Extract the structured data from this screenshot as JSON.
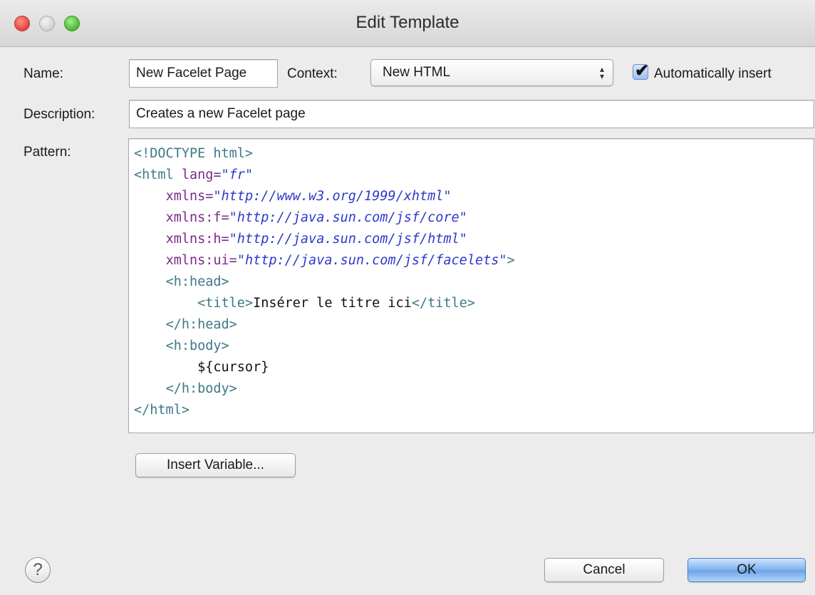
{
  "window": {
    "title": "Edit Template"
  },
  "form": {
    "name_label": "Name:",
    "name_value": "New Facelet Page",
    "context_label": "Context:",
    "context_value": "New HTML",
    "auto_insert_label": "Automatically insert",
    "auto_insert_checked": true,
    "description_label": "Description:",
    "description_value": "Creates a new Facelet page",
    "pattern_label": "Pattern:"
  },
  "pattern": {
    "lines": [
      [
        {
          "t": "tag",
          "s": "<!DOCTYPE html>"
        }
      ],
      [
        {
          "t": "tag",
          "s": "<html "
        },
        {
          "t": "attr",
          "s": "lang="
        },
        {
          "t": "val",
          "s": "\"fr\""
        }
      ],
      [
        {
          "t": "txt",
          "s": "    "
        },
        {
          "t": "attr",
          "s": "xmlns="
        },
        {
          "t": "val",
          "s": "\"http://www.w3.org/1999/xhtml\""
        }
      ],
      [
        {
          "t": "txt",
          "s": "    "
        },
        {
          "t": "attr",
          "s": "xmlns:f="
        },
        {
          "t": "val",
          "s": "\"http://java.sun.com/jsf/core\""
        }
      ],
      [
        {
          "t": "txt",
          "s": "    "
        },
        {
          "t": "attr",
          "s": "xmlns:h="
        },
        {
          "t": "val",
          "s": "\"http://java.sun.com/jsf/html\""
        }
      ],
      [
        {
          "t": "txt",
          "s": "    "
        },
        {
          "t": "attr",
          "s": "xmlns:ui="
        },
        {
          "t": "val",
          "s": "\"http://java.sun.com/jsf/facelets\""
        },
        {
          "t": "tag",
          "s": ">"
        }
      ],
      [
        {
          "t": "txt",
          "s": "    "
        },
        {
          "t": "tag",
          "s": "<h:head>"
        }
      ],
      [
        {
          "t": "txt",
          "s": "        "
        },
        {
          "t": "tag",
          "s": "<title>"
        },
        {
          "t": "txt",
          "s": "Insérer le titre ici"
        },
        {
          "t": "tag",
          "s": "</title>"
        }
      ],
      [
        {
          "t": "txt",
          "s": "    "
        },
        {
          "t": "tag",
          "s": "</h:head>"
        }
      ],
      [
        {
          "t": "txt",
          "s": "    "
        },
        {
          "t": "tag",
          "s": "<h:body>"
        }
      ],
      [
        {
          "t": "txt",
          "s": "        ${cursor}"
        }
      ],
      [
        {
          "t": "txt",
          "s": "    "
        },
        {
          "t": "tag",
          "s": "</h:body>"
        }
      ],
      [
        {
          "t": "tag",
          "s": "</html>"
        }
      ]
    ]
  },
  "buttons": {
    "insert_variable": "Insert Variable...",
    "cancel": "Cancel",
    "ok": "OK",
    "help": "?"
  },
  "colors": {
    "tag": "#3c7a86",
    "attribute": "#7b2a8a",
    "value": "#2c39c9",
    "ok_button": "#6aa3ea"
  },
  "icons": {
    "help": "question-mark-circle-icon",
    "checkbox": "checkmark-icon",
    "select": "up-down-arrows-icon"
  }
}
